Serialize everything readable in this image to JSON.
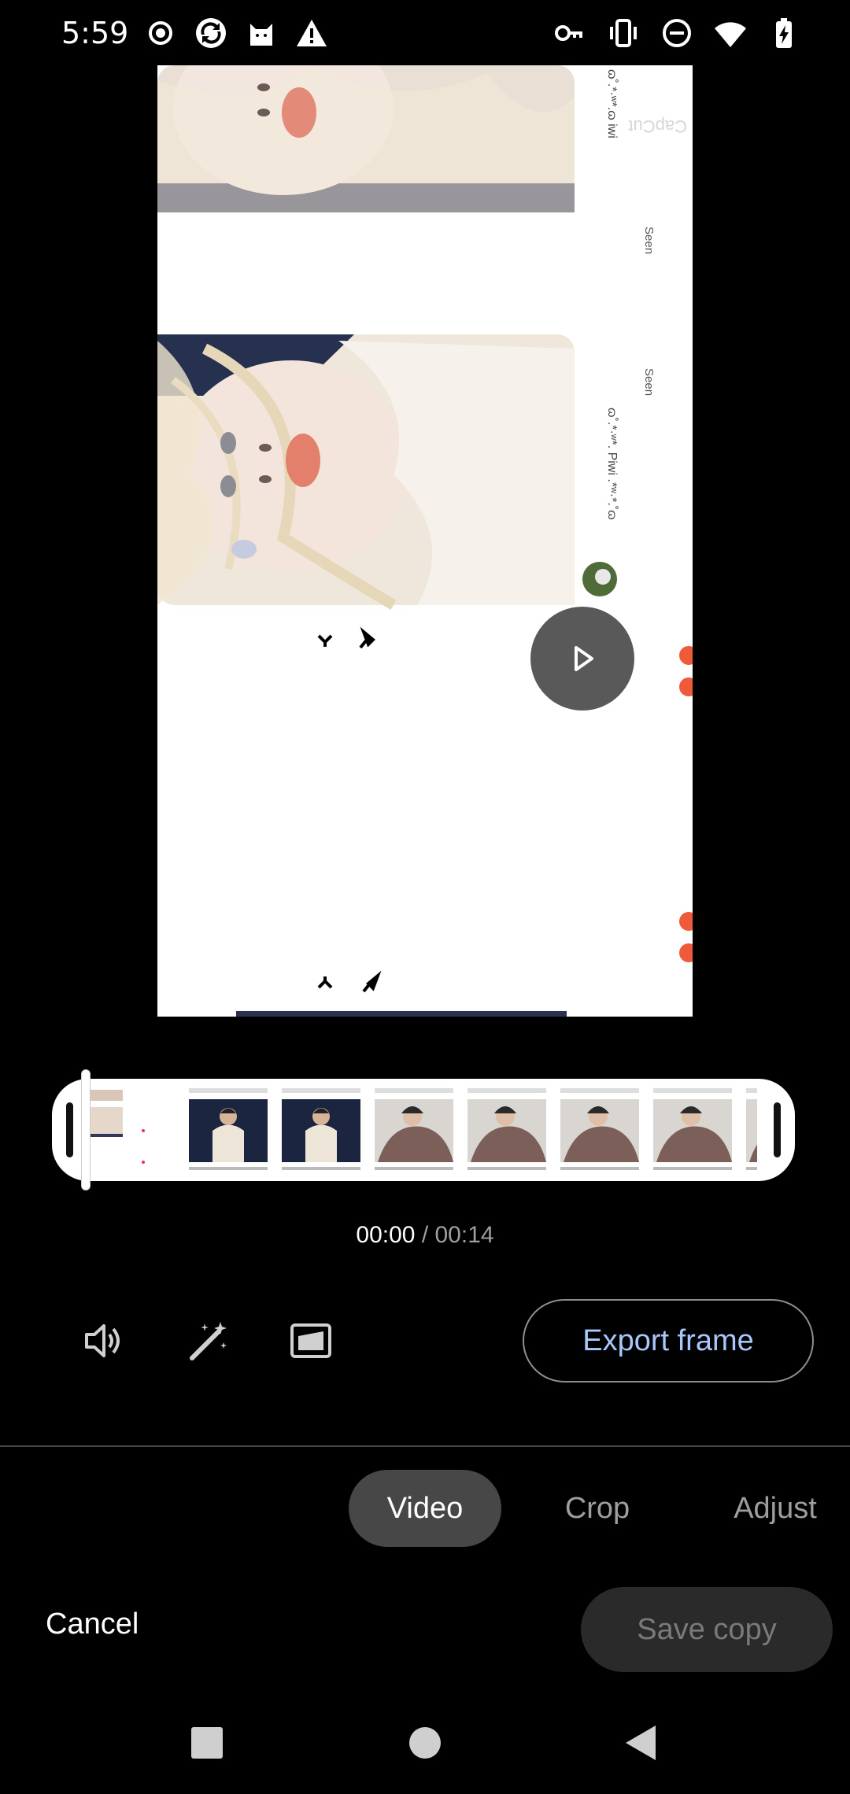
{
  "status_bar": {
    "time": "5:59",
    "left_icons": [
      "record-icon",
      "sync-app-icon",
      "cat-app-icon",
      "warning-icon"
    ],
    "right_icons": [
      "vpn-key-icon",
      "vibrate-icon",
      "do-not-disturb-icon",
      "wifi-icon",
      "battery-charging-icon"
    ]
  },
  "preview": {
    "watermark": "CapCut",
    "post_top": {
      "username": "ɷ˚.*·ʷ*.ɷ iwi",
      "seen": "Seen"
    },
    "post_main": {
      "username": "ɷ˚.*·ʷ*. Piwi .*ʷ·*.˚ɷ",
      "seen": "Seen"
    },
    "play_button": "play-icon"
  },
  "timeline": {
    "current_time": "00:00",
    "separator": " / ",
    "total_time": "00:14",
    "thumb_count_label": ""
  },
  "tools": {
    "mute": "volume-icon",
    "enhance": "magic-wand-icon",
    "aspect": "frame-icon",
    "export_frame_label": "Export frame"
  },
  "tabs": [
    {
      "label": "Video",
      "active": true
    },
    {
      "label": "Crop",
      "active": false
    },
    {
      "label": "Adjust",
      "active": false
    }
  ],
  "actions": {
    "cancel_label": "Cancel",
    "save_copy_label": "Save copy"
  },
  "nav": [
    "recents-square-icon",
    "home-circle-icon",
    "back-triangle-icon"
  ],
  "colors": {
    "accent_text": "#a8c7fa",
    "active_tab_bg": "#474747",
    "background": "#000000"
  }
}
